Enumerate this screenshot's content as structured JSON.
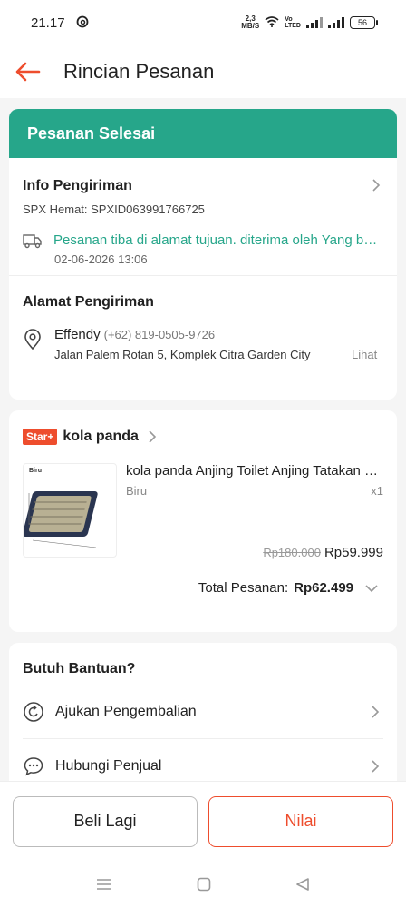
{
  "status_bar": {
    "time": "21.17",
    "net_speed_value": "2,3",
    "net_speed_unit": "MB/S",
    "volte_top": "Vo",
    "volte_bottom": "LTED",
    "battery": "56"
  },
  "header": {
    "title": "Rincian Pesanan"
  },
  "order_status": "Pesanan Selesai",
  "shipping": {
    "title": "Info Pengiriman",
    "tracking": "SPX Hemat: SPXID063991766725",
    "status": "Pesanan tiba di alamat tujuan. diterima oleh Yang bersangkutan",
    "time": "02-06-2026 13:06"
  },
  "address": {
    "title": "Alamat Pengiriman",
    "name": "Effendy",
    "phone": "(+62) 819-0505-9726",
    "line": "Jalan Palem Rotan 5, Komplek Citra Garden City",
    "more_label": "Lihat"
  },
  "shop": {
    "badge": "Star+",
    "name": "kola panda"
  },
  "product": {
    "name": "kola panda Anjing Toilet Anjing Tatakan Pipis",
    "variant": "Biru",
    "quantity": "x1",
    "original_price": "Rp180.000",
    "price": "Rp59.999",
    "image_label": "Biru"
  },
  "total": {
    "label": "Total Pesanan:",
    "value": "Rp62.499"
  },
  "help": {
    "title": "Butuh Bantuan?",
    "items": [
      {
        "label": "Ajukan Pengembalian",
        "icon": "return-icon"
      },
      {
        "label": "Hubungi Penjual",
        "icon": "chat-icon"
      }
    ]
  },
  "actions": {
    "buy_again": "Beli Lagi",
    "rate": "Nilai"
  },
  "colors": {
    "accent_green": "#26a68a",
    "brand_orange": "#ee4d2d"
  }
}
